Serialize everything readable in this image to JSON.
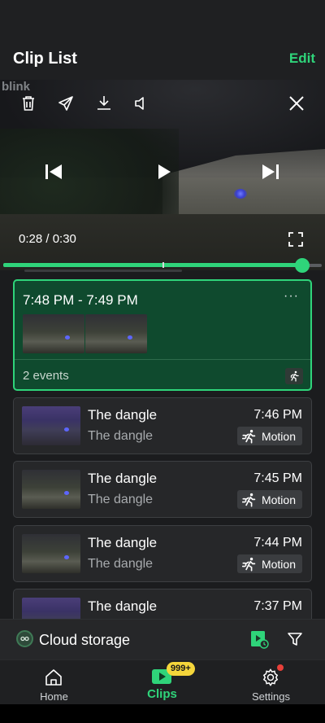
{
  "header": {
    "title": "Clip List",
    "edit_label": "Edit"
  },
  "player": {
    "watermark": "blink",
    "time_readout": "0:28 / 0:30",
    "progress": 0.94,
    "icons": [
      "trash-icon",
      "share-icon",
      "download-icon",
      "volume-icon",
      "close-icon",
      "skip-back-icon",
      "play-icon",
      "skip-forward-icon",
      "fullscreen-icon"
    ]
  },
  "group": {
    "time_range": "7:48 PM - 7:49 PM",
    "more": "···",
    "events_label": "2 events"
  },
  "clips": [
    {
      "title": "The dangle",
      "subtitle": "The dangle",
      "time": "7:46 PM",
      "badge": "Motion",
      "thumb": "purple"
    },
    {
      "title": "The dangle",
      "subtitle": "The dangle",
      "time": "7:45 PM",
      "badge": "Motion",
      "thumb": "green"
    },
    {
      "title": "The dangle",
      "subtitle": "The dangle",
      "time": "7:44 PM",
      "badge": "Motion",
      "thumb": "green"
    },
    {
      "title": "The dangle",
      "subtitle": "",
      "time": "7:37 PM",
      "badge": "",
      "thumb": "purple"
    }
  ],
  "storage": {
    "label": "Cloud storage"
  },
  "tabs": [
    {
      "label": "Home",
      "icon": "home-icon"
    },
    {
      "label": "Clips",
      "icon": "clips-icon",
      "badge": "999+"
    },
    {
      "label": "Settings",
      "icon": "gear-icon"
    }
  ],
  "colors": {
    "accent": "#2fd47a",
    "card": "#262729",
    "selected_card": "#0f4a2e",
    "badge": "#f4d53b",
    "alert_dot": "#e8403a"
  }
}
